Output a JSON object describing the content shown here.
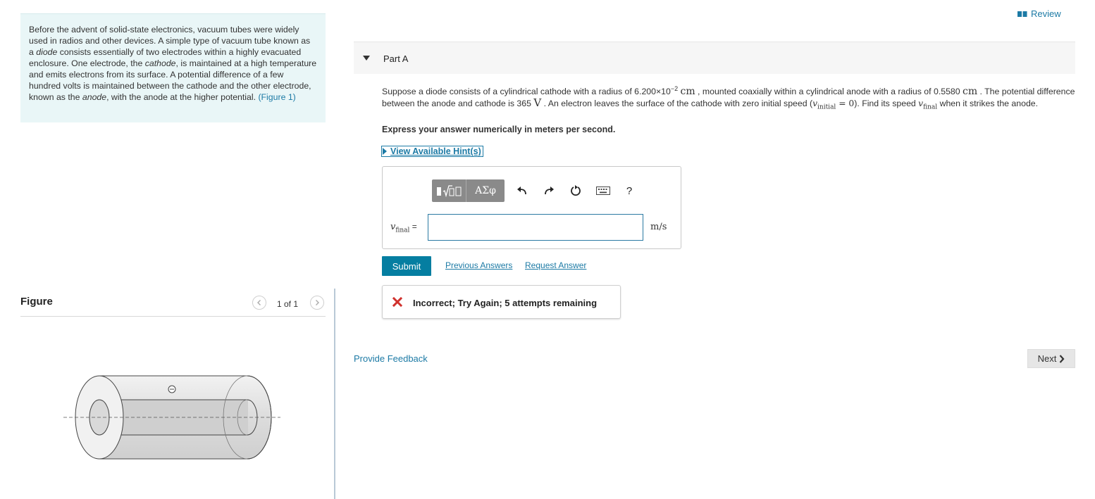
{
  "intro": {
    "t1": "Before the advent of solid-state electronics, vacuum tubes were widely used in radios and other devices. A simple type of vacuum tube known as a ",
    "diode": "diode",
    "t2": " consists essentially of two electrodes within a highly evacuated enclosure. One electrode, the ",
    "cathode": "cathode",
    "t3": ", is maintained at a high temperature and emits electrons from its surface. A potential difference of a few hundred volts is maintained between the cathode and the other electrode, known as the ",
    "anode": "anode",
    "t4": ", with the anode at the higher potential. ",
    "figure_link": "(Figure 1)"
  },
  "figure_panel": {
    "title": "Figure",
    "pager": "1 of 1"
  },
  "header": {
    "review": "Review"
  },
  "part": {
    "label": "Part A"
  },
  "question": {
    "q1": "Suppose a diode consists of a cylindrical cathode with a radius of 6.200×10",
    "exp": "−2",
    "unit_cm": "cm",
    "q2": " , mounted coaxially within a cylindrical anode with a radius of 0.5580 ",
    "unit_cm2": "cm",
    "q3": " . The potential difference between the anode and cathode is 365 ",
    "unit_v": "V",
    "q4": " . An electron leaves the surface of the cathode with zero initial speed (",
    "v_initial": "v",
    "v_initial_sub": "initial",
    "eq_zero": " = 0",
    "q5": "). Find its speed ",
    "v_final": "v",
    "v_final_sub": "final",
    "q6": " when it strikes the anode."
  },
  "instruction": "Express your answer numerically in meters per second.",
  "hint_label": "View Available Hint(s)",
  "answer": {
    "tool_greek": "ΑΣφ",
    "help": "?",
    "var": "v",
    "var_sub": "final",
    "eq": " =",
    "value": "",
    "unit": "m/s"
  },
  "actions": {
    "submit": "Submit",
    "previous": "Previous Answers",
    "request": "Request Answer"
  },
  "feedback": {
    "text": "Incorrect; Try Again; 5 attempts remaining"
  },
  "footer": {
    "provide_feedback": "Provide Feedback",
    "next": "Next"
  }
}
